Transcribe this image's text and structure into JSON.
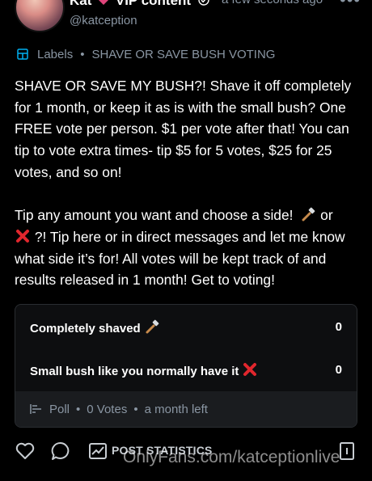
{
  "header": {
    "display_name": "Kat",
    "display_name_suffix": "VIP content",
    "timestamp": "a few seconds ago",
    "handle": "@katception",
    "more_icon": "more-horizontal-icon"
  },
  "labels": {
    "label": "Labels",
    "separator": "•",
    "value": "SHAVE OR SAVE BUSH VOTING"
  },
  "post": {
    "paragraph_1": "SHAVE OR SAVE MY BUSH?! Shave it off completely for 1 month, or keep it as is with the small bush? One FREE vote per person. $1 per vote after that! You can tip to vote extra times- tip $5 for 5 votes, $25 for 25 votes, and so on!",
    "paragraph_2_a": "Tip any amount you want and choose a side!",
    "paragraph_2_b": "or",
    "paragraph_2_c": "?! Tip here or in direct messages and let me know what side it’s for! All votes will be kept track of and results released in 1 month! Get to voting!"
  },
  "poll": {
    "options": [
      {
        "label": "Completely shaved",
        "emoji": "razor-icon",
        "count": "0"
      },
      {
        "label": "Small bush like you normally have it",
        "emoji": "cross-mark-icon",
        "count": "0"
      }
    ],
    "footer": {
      "type": "Poll",
      "votes": "0 Votes",
      "time_left": "a month left",
      "separator": "•"
    }
  },
  "actions": {
    "like_icon": "heart-icon",
    "comment_icon": "comment-icon",
    "stats_label": "POST STATISTICS",
    "bookmark_icon": "bookmark-icon"
  },
  "watermark": "OnlyFans.com/katceptionlive",
  "colors": {
    "background": "#000000",
    "muted": "#8a96a3",
    "accent": "#00aff0",
    "heart": "#e0457b",
    "cross": "#e0262d"
  }
}
